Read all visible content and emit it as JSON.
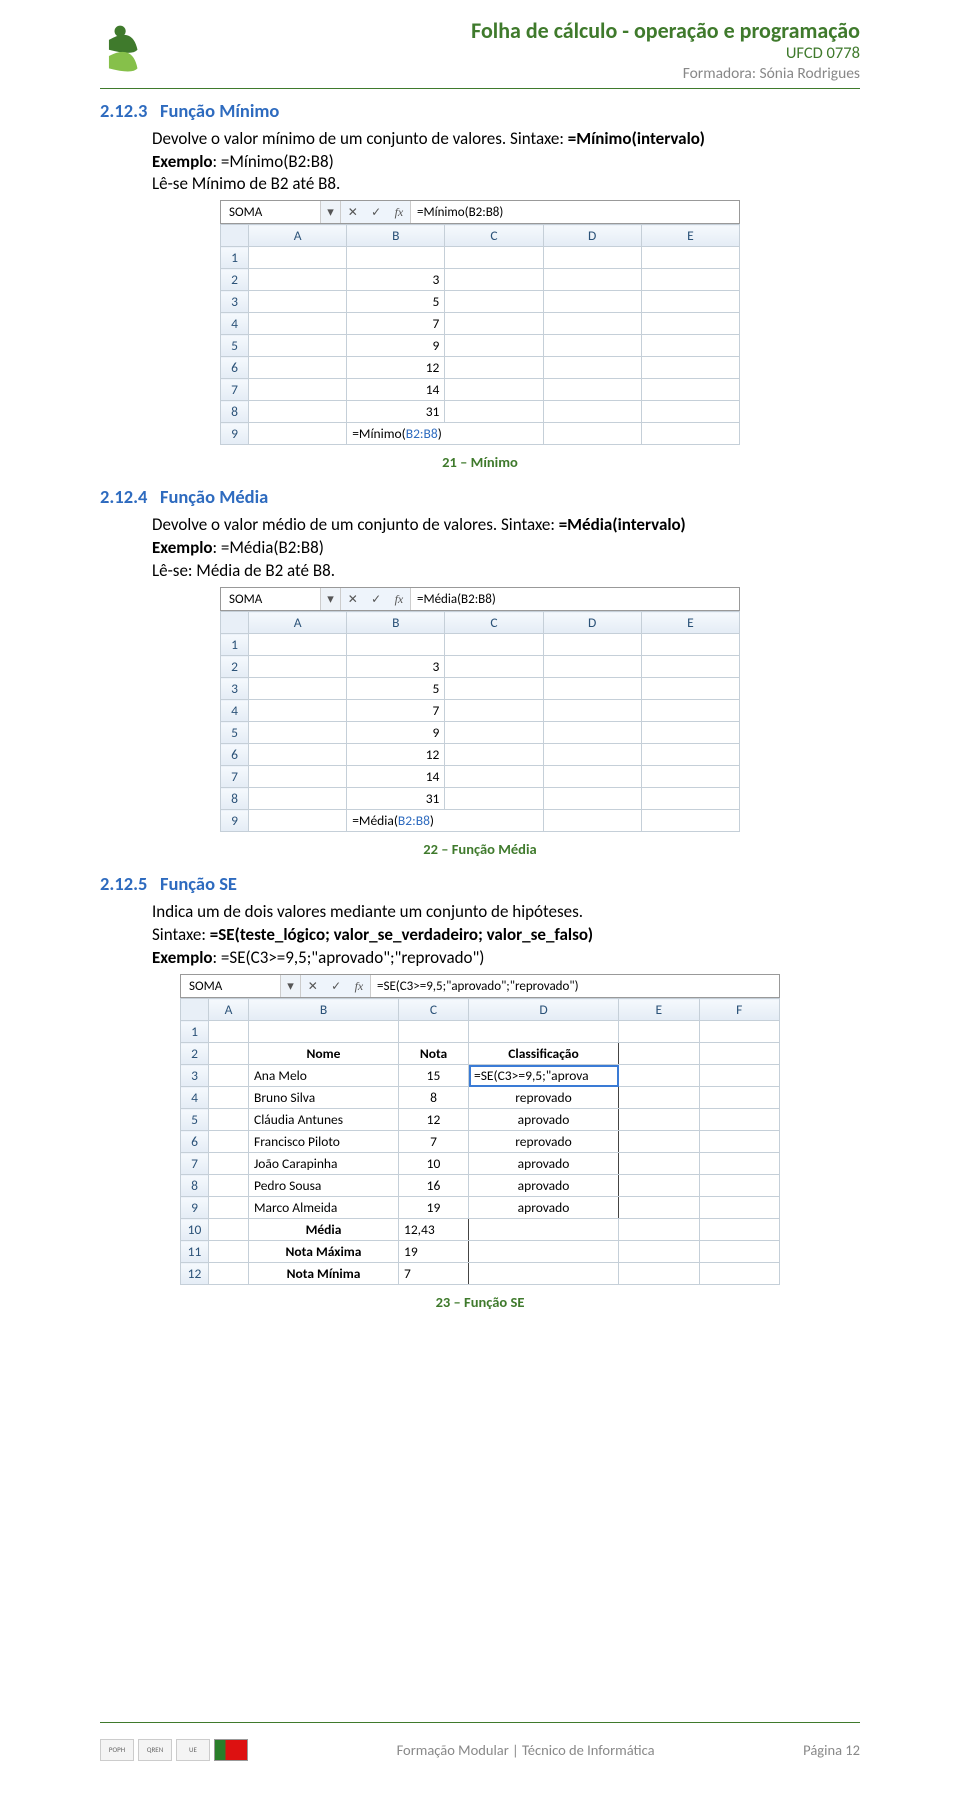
{
  "header": {
    "title": "Folha de cálculo - operação e programação",
    "ufcd": "UFCD 0778",
    "formadora": "Formadora: Sónia Rodrigues"
  },
  "sections": {
    "s1": {
      "num": "2.12.3",
      "title": "Função Mínimo",
      "desc": "Devolve o valor mínimo de um conjunto de valores. Sintaxe: ",
      "syntax": "=Mínimo(intervalo)",
      "ex_label": "Exemplo",
      "ex_val": ": =Mínimo(B2:B8)",
      "read": "Lê-se Mínimo de B2 até B8.",
      "caption": "21 – Mínimo"
    },
    "s2": {
      "num": "2.12.4",
      "title": "Função Média",
      "desc": "Devolve o valor médio de um conjunto de valores. Sintaxe: ",
      "syntax": "=Média(intervalo)",
      "ex_label": "Exemplo",
      "ex_val": ": =Média(B2:B8)",
      "read": "Lê-se: Média de B2 até B8.",
      "caption": "22 – Função Média"
    },
    "s3": {
      "num": "2.12.5",
      "title": "Função SE",
      "desc": "Indica um de dois valores mediante um conjunto de hipóteses.",
      "syn_label": "Sintaxe: ",
      "syntax": "=SE(teste_lógico; valor_se_verdadeiro; valor_se_falso)",
      "ex_label": "Exemplo",
      "ex_val": ": =SE(C3>=9,5;\"aprovado\";\"reprovado\")",
      "caption": "23 – Função SE"
    }
  },
  "sheet1": {
    "namebox": "SOMA",
    "formula": "=Mínimo(B2:B8)",
    "cols": [
      "A",
      "B",
      "C",
      "D",
      "E"
    ],
    "rows": [
      {
        "n": "1",
        "b": ""
      },
      {
        "n": "2",
        "b": "3"
      },
      {
        "n": "3",
        "b": "5"
      },
      {
        "n": "4",
        "b": "7"
      },
      {
        "n": "5",
        "b": "9"
      },
      {
        "n": "6",
        "b": "12"
      },
      {
        "n": "7",
        "b": "14"
      },
      {
        "n": "8",
        "b": "31"
      }
    ],
    "active": {
      "n": "9",
      "prefix": "=Mínimo(",
      "ref": "B2:B8",
      "suffix": ")"
    }
  },
  "sheet2": {
    "namebox": "SOMA",
    "formula": "=Média(B2:B8)",
    "cols": [
      "A",
      "B",
      "C",
      "D",
      "E"
    ],
    "rows": [
      {
        "n": "1",
        "b": ""
      },
      {
        "n": "2",
        "b": "3"
      },
      {
        "n": "3",
        "b": "5"
      },
      {
        "n": "4",
        "b": "7"
      },
      {
        "n": "5",
        "b": "9"
      },
      {
        "n": "6",
        "b": "12"
      },
      {
        "n": "7",
        "b": "14"
      },
      {
        "n": "8",
        "b": "31"
      }
    ],
    "active": {
      "n": "9",
      "prefix": "=Média(",
      "ref": "B2:B8",
      "suffix": ")"
    }
  },
  "sheet3": {
    "namebox": "SOMA",
    "formula": "=SE(C3>=9,5;\"aprovado\";\"reprovado\")",
    "cols": [
      "A",
      "B",
      "C",
      "D",
      "E",
      "F"
    ],
    "hdr": {
      "b": "Nome",
      "c": "Nota",
      "d": "Classificação"
    },
    "rows": [
      {
        "n": "3",
        "b": "Ana Melo",
        "c": "15",
        "d": "=SE(C3>=9,5;\"aprova",
        "active": true
      },
      {
        "n": "4",
        "b": "Bruno Silva",
        "c": "8",
        "d": "reprovado"
      },
      {
        "n": "5",
        "b": "Cláudia Antunes",
        "c": "12",
        "d": "aprovado"
      },
      {
        "n": "6",
        "b": "Francisco Piloto",
        "c": "7",
        "d": "reprovado"
      },
      {
        "n": "7",
        "b": "João Carapinha",
        "c": "10",
        "d": "aprovado"
      },
      {
        "n": "8",
        "b": "Pedro Sousa",
        "c": "16",
        "d": "aprovado"
      },
      {
        "n": "9",
        "b": "Marco Almeida",
        "c": "19",
        "d": "aprovado"
      }
    ],
    "summary": [
      {
        "n": "10",
        "b": "Média",
        "c": "12,43"
      },
      {
        "n": "11",
        "b": "Nota Máxima",
        "c": "19"
      },
      {
        "n": "12",
        "b": "Nota Mínima",
        "c": "7"
      }
    ]
  },
  "footer": {
    "text": "Formação Modular | Técnico de Informática",
    "page_label": "Página ",
    "page_num": "12"
  },
  "icons": {
    "dropdown": "▾",
    "cancel": "✕",
    "accept": "✓",
    "fx": "fx"
  }
}
